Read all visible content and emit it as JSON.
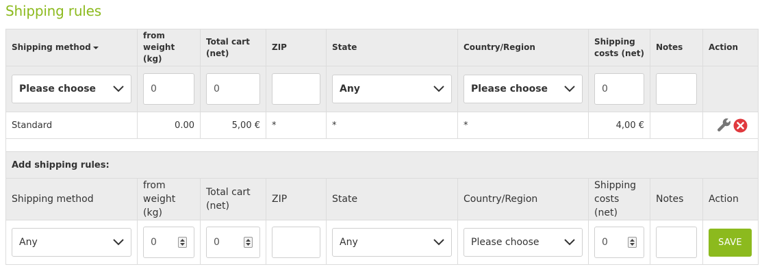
{
  "title": "Shipping rules",
  "colors": {
    "accent": "#8cba1e",
    "delete": "#e0393e",
    "header_bg": "#ececec"
  },
  "columns": {
    "method": "Shipping method",
    "weight": "from weight (kg)",
    "cart": "Total cart (net)",
    "zip": "ZIP",
    "state": "State",
    "country": "Country/Region",
    "costs": "Shipping costs (net)",
    "notes": "Notes",
    "action": "Action"
  },
  "filters": {
    "method": "Please choose",
    "weight": "0",
    "cart": "0",
    "zip": "",
    "state": "Any",
    "country": "Please choose",
    "costs": "0",
    "notes": ""
  },
  "rows": [
    {
      "method": "Standard",
      "weight": "0.00",
      "cart": "5,00 €",
      "zip": "*",
      "state": "*",
      "country": "*",
      "costs": "4,00 €",
      "notes": "",
      "actions": [
        "wrench-icon",
        "delete-icon"
      ]
    }
  ],
  "add_form": {
    "title": "Add shipping rules:",
    "columns": {
      "method": "Shipping method",
      "weight": "from weight (kg)",
      "cart": "Total cart (net)",
      "zip": "ZIP",
      "state": "State",
      "country": "Country/Region",
      "costs": "Shipping costs (net)",
      "notes": "Notes",
      "action": "Action"
    },
    "values": {
      "method": "Any",
      "weight": "0",
      "cart": "0",
      "zip": "",
      "state": "Any",
      "country": "Please choose",
      "costs": "0",
      "notes": ""
    },
    "save_label": "SAVE"
  }
}
